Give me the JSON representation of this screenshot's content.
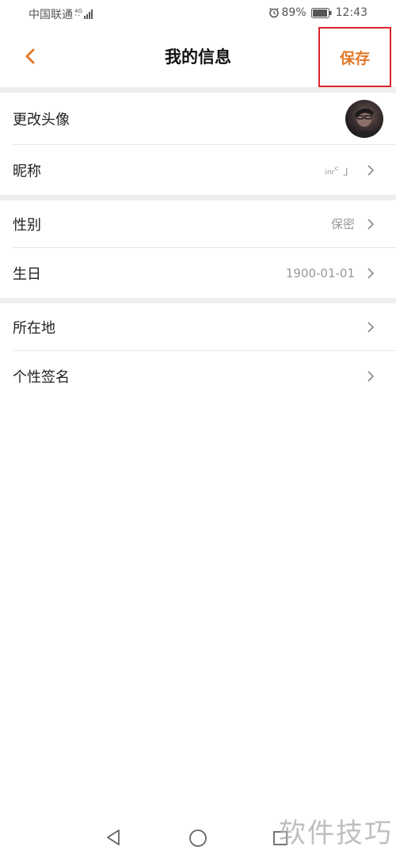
{
  "status_bar": {
    "carrier": "中国联通",
    "network_top": "4G",
    "network_bottom": "⁺⁺",
    "battery": "89%",
    "time": "12:43"
  },
  "header": {
    "title": "我的信息",
    "save_label": "保存"
  },
  "rows": {
    "avatar": {
      "label": "更改头像"
    },
    "nickname": {
      "label": "昵称",
      "value": "ᵢₙᵣᶜ 」"
    },
    "gender": {
      "label": "性别",
      "value": "保密"
    },
    "birthday": {
      "label": "生日",
      "value": "1900-01-01"
    },
    "location": {
      "label": "所在地"
    },
    "signature": {
      "label": "个性签名"
    }
  },
  "watermark": "软件技巧",
  "colors": {
    "accent": "#e17a2a",
    "highlight_border": "#d9262c",
    "separator": "#eeeeee"
  }
}
